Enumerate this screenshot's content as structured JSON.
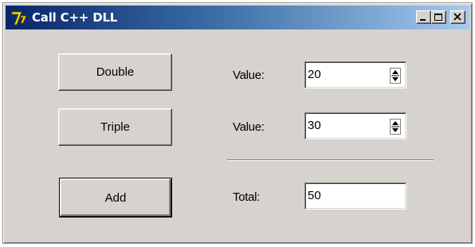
{
  "window": {
    "title": "Call C++ DLL",
    "title_color": "#ffffff",
    "titlebar_gradient": [
      "#0a246a",
      "#a6caf0"
    ]
  },
  "buttons": {
    "double_label": "Double",
    "triple_label": "Triple",
    "add_label": "Add"
  },
  "rows": {
    "value1": {
      "label": "Value:",
      "value": "20"
    },
    "value2": {
      "label": "Value:",
      "value": "30"
    },
    "total": {
      "label": "Total:",
      "value": "50"
    }
  },
  "icons": {
    "app": "app-icon",
    "minimize": "minimize-icon",
    "maximize": "maximize-icon",
    "close": "close-icon",
    "spin": "spin-updown-icon"
  },
  "colors": {
    "face": "#d6d3ce",
    "field_bg": "#ffffff"
  }
}
